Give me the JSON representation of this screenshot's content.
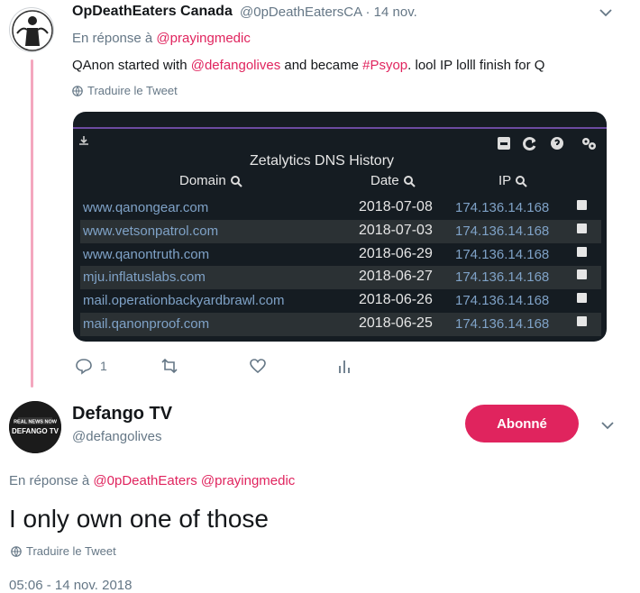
{
  "colors": {
    "accent": "#e0245e",
    "secondary_text": "#657786",
    "thread_line": "#f4a7be"
  },
  "tweet1": {
    "avatar_icon": "anonymous-mask-avatar",
    "display_name": "OpDeathEaters Canada",
    "handle": "@0pDeathEatersCA",
    "separator": "·",
    "date": "14 nov.",
    "reply_prefix": "En réponse à",
    "reply_to": "@prayingmedic",
    "text_1": "QAnon started with ",
    "mention": "@defangolives",
    "text_2": " and became ",
    "hashtag": "#Psyop",
    "text_3": ". lool IP lolll  finish for Q",
    "translate_label": "Traduire le Tweet",
    "media": {
      "title": "Zetalytics DNS History",
      "columns": [
        "Domain",
        "Date",
        "IP"
      ],
      "rows": [
        {
          "domain": "www.qanongear.com",
          "date": "2018-07-08",
          "ip": "174.136.14.168"
        },
        {
          "domain": "www.vetsonpatrol.com",
          "date": "2018-07-03",
          "ip": "174.136.14.168"
        },
        {
          "domain": "www.qanontruth.com",
          "date": "2018-06-29",
          "ip": "174.136.14.168"
        },
        {
          "domain": "mju.inflatuslabs.com",
          "date": "2018-06-27",
          "ip": "174.136.14.168"
        },
        {
          "domain": "mail.operationbackyardbrawl.com",
          "date": "2018-06-26",
          "ip": "174.136.14.168"
        },
        {
          "domain": "mail.qanonproof.com",
          "date": "2018-06-25",
          "ip": "174.136.14.168"
        }
      ]
    },
    "reply_count": "1"
  },
  "tweet2": {
    "avatar_icon": "defango-tv-avatar",
    "avatar_line1": "REAL NEWS NOW",
    "avatar_line2": "DEFANGO TV",
    "display_name": "Defango TV",
    "handle": "@defangolives",
    "follow_label": "Abonné",
    "reply_prefix": "En réponse à",
    "reply_to_1": "@0pDeathEaters",
    "reply_to_2": "@prayingmedic",
    "text": "I only own one of those",
    "translate_label": "Traduire le Tweet",
    "timestamp": "05:06 - 14 nov. 2018"
  }
}
